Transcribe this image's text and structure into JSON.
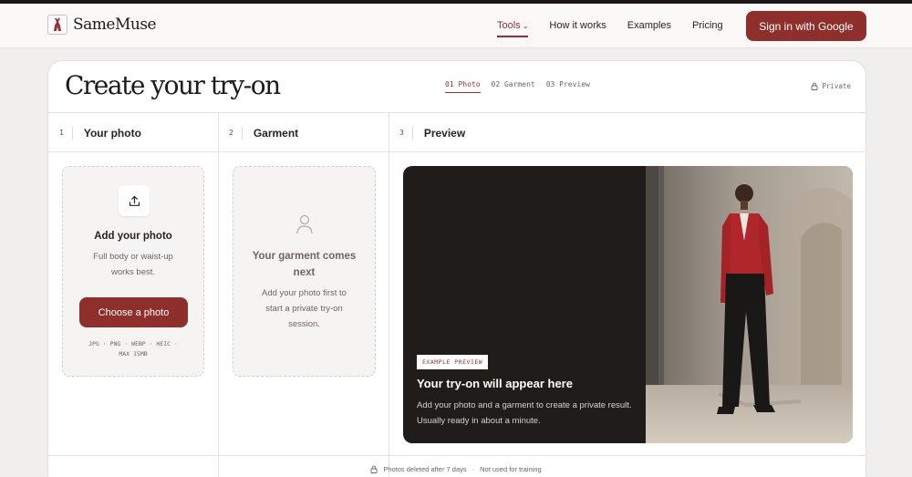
{
  "nav": {
    "brand": "SameMuse",
    "links": [
      {
        "label": "Tools",
        "chevron": "⌄",
        "active": true
      },
      {
        "label": "How it works"
      },
      {
        "label": "Examples"
      },
      {
        "label": "Pricing"
      }
    ],
    "signin_label": "Sign in with Google"
  },
  "header": {
    "title": "Create your try-on",
    "steps": [
      "01 Photo",
      "02 Garment",
      "03 Preview"
    ],
    "private_label": "Private"
  },
  "columns": [
    {
      "num": "1",
      "title": "Your photo"
    },
    {
      "num": "2",
      "title": "Garment"
    },
    {
      "num": "3",
      "title": "Preview"
    }
  ],
  "photo_panel": {
    "title": "Add your photo",
    "desc_line1": "Full body or waist-up",
    "desc_line2": "works best.",
    "button_label": "Choose a photo",
    "formats_line1": "JPG · PNG · WEBP · HEIC ·",
    "formats_line2": "MAX 15MB"
  },
  "garment_panel": {
    "title_line1": "Your garment comes",
    "title_line2": "next",
    "desc_line1": "Add your photo first to",
    "desc_line2": "start a private try-on",
    "desc_line3": "session."
  },
  "preview": {
    "badge": "EXAMPLE PREVIEW",
    "title": "Your try-on will appear here",
    "desc": "Add your photo and a garment to create a private result. Usually ready in about a minute."
  },
  "footer": {
    "deleted": "Photos deleted after 7 days",
    "separator": "·",
    "training": "Not used for training"
  },
  "colors": {
    "accent": "#8e2f2b",
    "accent_text": "#9b2f2f",
    "background": "#f1efed",
    "card": "#ffffff",
    "preview_dark": "#1f1c1a"
  }
}
